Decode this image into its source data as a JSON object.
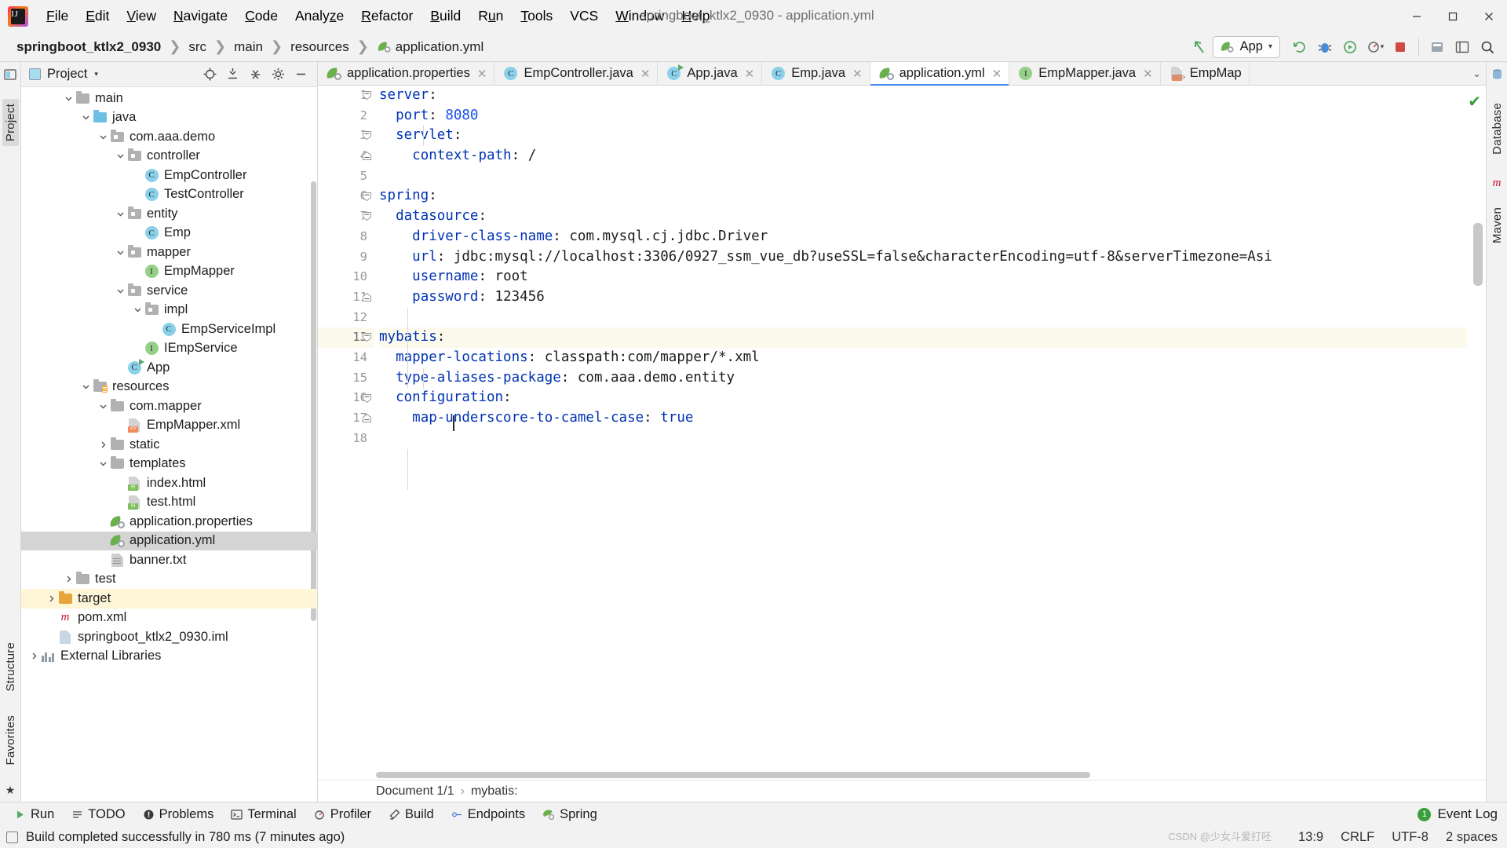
{
  "window": {
    "title": "springboot_ktlx2_0930 - application.yml",
    "minimize": "—",
    "maximize": "▫",
    "close": "✕"
  },
  "menu": [
    {
      "label": "File",
      "accel": "F"
    },
    {
      "label": "Edit",
      "accel": "E"
    },
    {
      "label": "View",
      "accel": "V"
    },
    {
      "label": "Navigate",
      "accel": "N"
    },
    {
      "label": "Code",
      "accel": "C"
    },
    {
      "label": "Analyze",
      "accel": "z"
    },
    {
      "label": "Refactor",
      "accel": "R"
    },
    {
      "label": "Build",
      "accel": "B"
    },
    {
      "label": "Run",
      "accel": "u"
    },
    {
      "label": "Tools",
      "accel": "T"
    },
    {
      "label": "VCS",
      "accel": ""
    },
    {
      "label": "Window",
      "accel": "W"
    },
    {
      "label": "Help",
      "accel": "H"
    }
  ],
  "breadcrumbs": [
    {
      "label": "springboot_ktlx2_0930",
      "bold": true,
      "icon": ""
    },
    {
      "label": "src",
      "bold": false,
      "icon": ""
    },
    {
      "label": "main",
      "bold": false,
      "icon": ""
    },
    {
      "label": "resources",
      "bold": false,
      "icon": ""
    },
    {
      "label": "application.yml",
      "bold": false,
      "icon": "spring-icon"
    }
  ],
  "toolbar": {
    "run_config": "App",
    "run_config_caret": "▾",
    "icons": [
      "back-arrow-icon",
      "rerun-icon",
      "debug-icon",
      "run-with-coverage-icon",
      "profile-icon",
      "stop-icon",
      "git-update-icon",
      "layout-icon",
      "search-icon"
    ]
  },
  "left_rail": {
    "tabs": [
      "Project",
      "Structure",
      "Favorites"
    ],
    "active": "Project"
  },
  "right_rail": {
    "tabs": [
      "Database",
      "Maven"
    ]
  },
  "project_panel": {
    "title": "Project",
    "caret": "▾",
    "actions": [
      "locate-icon",
      "expand-all-icon",
      "collapse-all-icon",
      "settings-icon",
      "hide-icon"
    ],
    "tree": [
      {
        "label": "main",
        "indent": 2,
        "arrow": "down",
        "icon": "folder-gray",
        "state": "normal"
      },
      {
        "label": "java",
        "indent": 3,
        "arrow": "down",
        "icon": "folder-blue",
        "state": "normal"
      },
      {
        "label": "com.aaa.demo",
        "indent": 4,
        "arrow": "down",
        "icon": "folder-package",
        "state": "normal"
      },
      {
        "label": "controller",
        "indent": 5,
        "arrow": "down",
        "icon": "folder-package",
        "state": "normal"
      },
      {
        "label": "EmpController",
        "indent": 6,
        "arrow": "none",
        "icon": "class-icon",
        "state": "normal"
      },
      {
        "label": "TestController",
        "indent": 6,
        "arrow": "none",
        "icon": "class-icon",
        "state": "normal"
      },
      {
        "label": "entity",
        "indent": 5,
        "arrow": "down",
        "icon": "folder-package",
        "state": "normal"
      },
      {
        "label": "Emp",
        "indent": 6,
        "arrow": "none",
        "icon": "class-icon",
        "state": "normal"
      },
      {
        "label": "mapper",
        "indent": 5,
        "arrow": "down",
        "icon": "folder-package",
        "state": "normal"
      },
      {
        "label": "EmpMapper",
        "indent": 6,
        "arrow": "none",
        "icon": "interface-icon",
        "state": "normal"
      },
      {
        "label": "service",
        "indent": 5,
        "arrow": "down",
        "icon": "folder-package",
        "state": "normal"
      },
      {
        "label": "impl",
        "indent": 6,
        "arrow": "down",
        "icon": "folder-package",
        "state": "normal"
      },
      {
        "label": "EmpServiceImpl",
        "indent": 7,
        "arrow": "none",
        "icon": "class-icon",
        "state": "normal"
      },
      {
        "label": "IEmpService",
        "indent": 6,
        "arrow": "none",
        "icon": "interface-icon",
        "state": "normal"
      },
      {
        "label": "App",
        "indent": 5,
        "arrow": "none",
        "icon": "springboot-class-icon",
        "state": "normal"
      },
      {
        "label": "resources",
        "indent": 3,
        "arrow": "down",
        "icon": "folder-resources",
        "state": "normal"
      },
      {
        "label": "com.mapper",
        "indent": 4,
        "arrow": "down",
        "icon": "folder-gray",
        "state": "normal"
      },
      {
        "label": "EmpMapper.xml",
        "indent": 5,
        "arrow": "none",
        "icon": "xml-file-icon",
        "state": "normal"
      },
      {
        "label": "static",
        "indent": 4,
        "arrow": "right",
        "icon": "folder-gray",
        "state": "normal"
      },
      {
        "label": "templates",
        "indent": 4,
        "arrow": "down",
        "icon": "folder-gray",
        "state": "normal"
      },
      {
        "label": "index.html",
        "indent": 5,
        "arrow": "none",
        "icon": "html-file-icon",
        "state": "normal"
      },
      {
        "label": "test.html",
        "indent": 5,
        "arrow": "none",
        "icon": "html-file-icon",
        "state": "normal"
      },
      {
        "label": "application.properties",
        "indent": 4,
        "arrow": "none",
        "icon": "spring-icon",
        "state": "normal"
      },
      {
        "label": "application.yml",
        "indent": 4,
        "arrow": "none",
        "icon": "spring-icon",
        "state": "selected"
      },
      {
        "label": "banner.txt",
        "indent": 4,
        "arrow": "none",
        "icon": "text-file-icon",
        "state": "normal"
      },
      {
        "label": "test",
        "indent": 2,
        "arrow": "right",
        "icon": "folder-gray",
        "state": "normal"
      },
      {
        "label": "target",
        "indent": 1,
        "arrow": "right",
        "icon": "folder-orange",
        "state": "highlight"
      },
      {
        "label": "pom.xml",
        "indent": 1,
        "arrow": "none",
        "icon": "maven-icon",
        "state": "normal"
      },
      {
        "label": "springboot_ktlx2_0930.iml",
        "indent": 1,
        "arrow": "none",
        "icon": "iml-file-icon",
        "state": "normal"
      },
      {
        "label": "External Libraries",
        "indent": 0,
        "arrow": "right",
        "icon": "library-icon",
        "state": "normal"
      }
    ]
  },
  "editor_tabs": [
    {
      "label": "application.properties",
      "icon": "spring-icon",
      "active": false,
      "close": "✕"
    },
    {
      "label": "EmpController.java",
      "icon": "class-icon",
      "active": false,
      "close": "✕"
    },
    {
      "label": "App.java",
      "icon": "springboot-class-icon",
      "active": false,
      "close": "✕"
    },
    {
      "label": "Emp.java",
      "icon": "class-icon",
      "active": false,
      "close": "✕"
    },
    {
      "label": "application.yml",
      "icon": "spring-icon",
      "active": true,
      "close": "✕"
    },
    {
      "label": "EmpMapper.java",
      "icon": "interface-icon",
      "active": false,
      "close": "✕"
    },
    {
      "label": "EmpMap",
      "icon": "xml-file-icon",
      "active": false,
      "close": ""
    }
  ],
  "editor_tabs_caret": "⌄",
  "editor": {
    "filename": "application.yml",
    "current_line": 13,
    "lines": [
      {
        "num": 1,
        "indent": 0,
        "key": "server",
        "value": "",
        "fold": "minus-top"
      },
      {
        "num": 2,
        "indent": 1,
        "key": "port",
        "value": "8080",
        "value_type": "number"
      },
      {
        "num": 3,
        "indent": 1,
        "key": "servlet",
        "value": "",
        "fold": "minus-top"
      },
      {
        "num": 4,
        "indent": 2,
        "key": "context-path",
        "value": "/",
        "fold": "minus-bottom"
      },
      {
        "num": 5,
        "indent": 0,
        "key": "",
        "value": ""
      },
      {
        "num": 6,
        "indent": 0,
        "key": "spring",
        "value": "",
        "fold": "minus-top"
      },
      {
        "num": 7,
        "indent": 1,
        "key": "datasource",
        "value": "",
        "fold": "minus-top"
      },
      {
        "num": 8,
        "indent": 2,
        "key": "driver-class-name",
        "value": "com.mysql.cj.jdbc.Driver"
      },
      {
        "num": 9,
        "indent": 2,
        "key": "url",
        "value": "jdbc:mysql://localhost:3306/0927_ssm_vue_db?useSSL=false&characterEncoding=utf-8&serverTimezone=Asi"
      },
      {
        "num": 10,
        "indent": 2,
        "key": "username",
        "value": "root"
      },
      {
        "num": 11,
        "indent": 2,
        "key": "password",
        "value": "123456",
        "fold": "minus-bottom"
      },
      {
        "num": 12,
        "indent": 0,
        "key": "",
        "value": ""
      },
      {
        "num": 13,
        "indent": 0,
        "key": "mybatis",
        "value": "",
        "fold": "minus-top",
        "current": true
      },
      {
        "num": 14,
        "indent": 1,
        "key": "mapper-locations",
        "value": "classpath:com/mapper/*.xml"
      },
      {
        "num": 15,
        "indent": 1,
        "key": "type-aliases-package",
        "value": "com.aaa.demo.entity"
      },
      {
        "num": 16,
        "indent": 1,
        "key": "configuration",
        "value": "",
        "fold": "minus-top"
      },
      {
        "num": 17,
        "indent": 2,
        "key": "map-underscore-to-camel-case",
        "value": "true",
        "value_type": "boolean",
        "fold": "minus-bottom"
      },
      {
        "num": 18,
        "indent": 0,
        "key": "",
        "value": ""
      }
    ],
    "inspection_status": "✔"
  },
  "editor_breadcrumb": {
    "document": "Document 1/1",
    "separator": "›",
    "path": "mybatis:"
  },
  "bottom_toolwindows": [
    {
      "label": "Run",
      "icon": "run-icon"
    },
    {
      "label": "TODO",
      "icon": "todo-icon"
    },
    {
      "label": "Problems",
      "icon": "problems-icon"
    },
    {
      "label": "Terminal",
      "icon": "terminal-icon"
    },
    {
      "label": "Profiler",
      "icon": "profiler-icon"
    },
    {
      "label": "Build",
      "icon": "build-icon"
    },
    {
      "label": "Endpoints",
      "icon": "endpoints-icon"
    },
    {
      "label": "Spring",
      "icon": "spring-icon"
    }
  ],
  "event_log": {
    "label": "Event Log",
    "badge": "1"
  },
  "status_bar": {
    "message": "Build completed successfully in 780 ms (7 minutes ago)",
    "caret_position": "13:9",
    "line_separator": "CRLF",
    "encoding": "UTF-8",
    "indent": "2 spaces",
    "watermark": "CSDN @少女斗爱打呸"
  }
}
